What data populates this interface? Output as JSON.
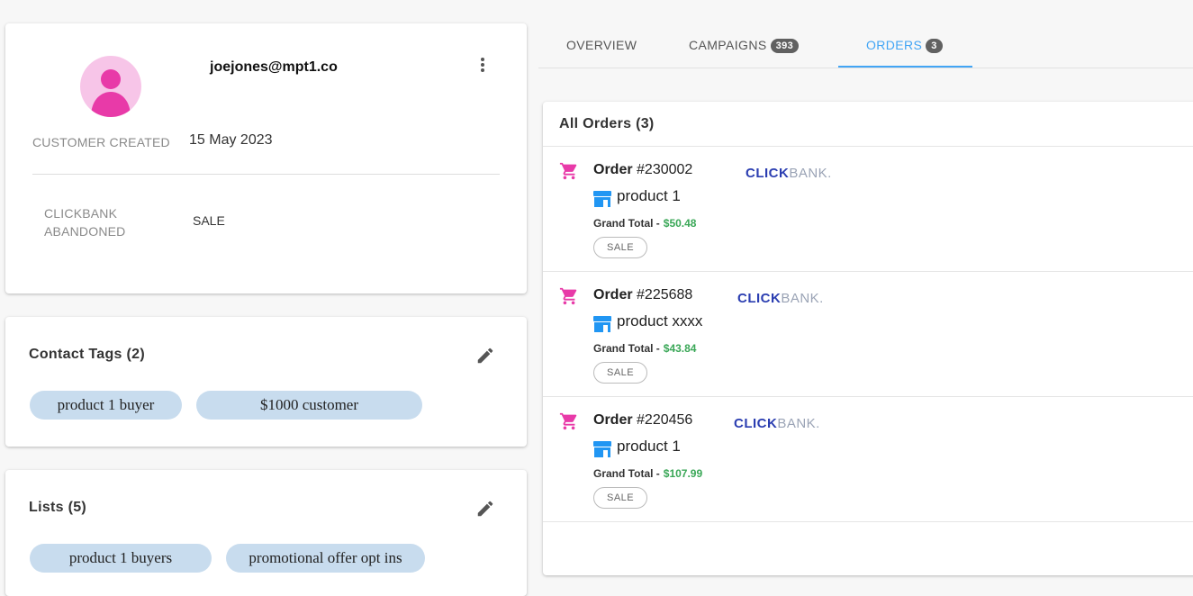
{
  "profile": {
    "email": "joejones@mpt1.co",
    "created_label": "CUSTOMER CREATED",
    "created_value": "15 May 2023",
    "abandoned_label_line1": "CLICKBANK",
    "abandoned_label_line2": "ABANDONED",
    "abandoned_value": "SALE"
  },
  "tags": {
    "title": "Contact Tags (2)",
    "items": [
      "product 1 buyer",
      "$1000 customer"
    ]
  },
  "lists": {
    "title": "Lists (5)",
    "items": [
      "product 1 buyers",
      "promotional offer opt ins"
    ]
  },
  "tabs": [
    {
      "label": "OVERVIEW",
      "badge": ""
    },
    {
      "label": "CAMPAIGNS",
      "badge": "393"
    },
    {
      "label": "ORDERS",
      "badge": "3"
    }
  ],
  "orders": {
    "title": "All Orders (3)",
    "items": [
      {
        "order_label": "Order",
        "number": "#230002",
        "product": "product 1",
        "grand_total_label": "Grand Total -",
        "amount": "$50.48",
        "status": "SALE",
        "vendor_a": "CLICK",
        "vendor_b": "BANK."
      },
      {
        "order_label": "Order",
        "number": "#225688",
        "product": "product xxxx",
        "grand_total_label": "Grand Total -",
        "amount": "$43.84",
        "status": "SALE",
        "vendor_a": "CLICK",
        "vendor_b": "BANK."
      },
      {
        "order_label": "Order",
        "number": "#220456",
        "product": "product 1",
        "grand_total_label": "Grand Total -",
        "amount": "$107.99",
        "status": "SALE",
        "vendor_a": "CLICK",
        "vendor_b": "BANK."
      }
    ]
  },
  "colors": {
    "accent": "#42a5f5",
    "avatar_bg": "#f7c5e8",
    "avatar_fg": "#e83aa8",
    "cart_icon": "#e83aa8",
    "store_icon": "#2196f3",
    "chip_bg": "#c8dcee",
    "total_green": "#3aa757"
  },
  "icons": {
    "more": "more-vert-icon",
    "edit": "pencil-icon",
    "cart": "shopping-cart-icon",
    "store": "storefront-icon",
    "avatar": "user-avatar-icon"
  }
}
